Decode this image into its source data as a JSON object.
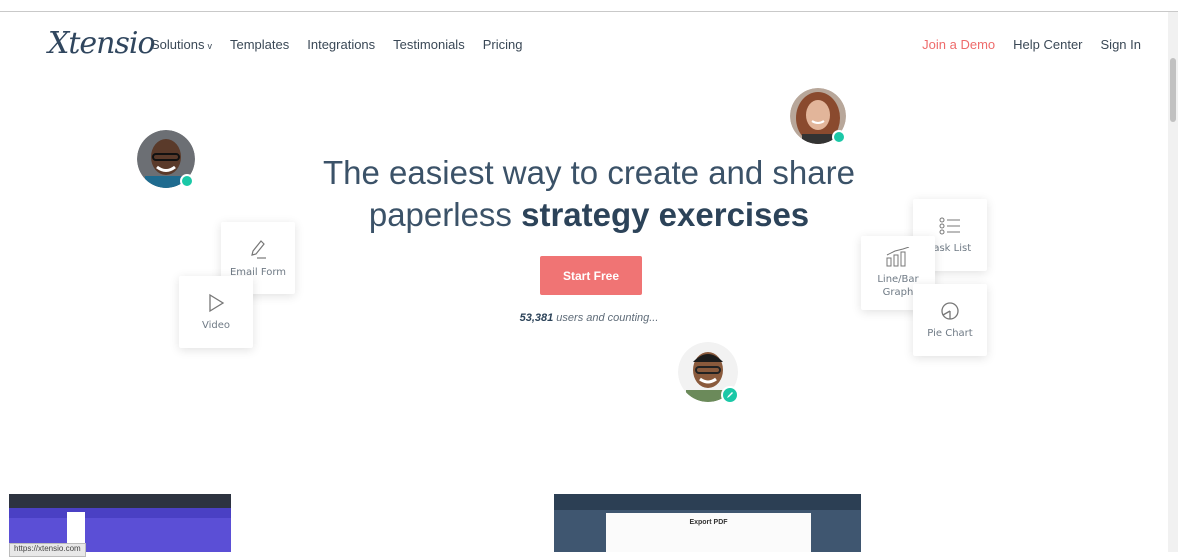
{
  "brand": {
    "logo": "Xtensio"
  },
  "nav": {
    "left": [
      "Solutions",
      "Templates",
      "Integrations",
      "Testimonials",
      "Pricing"
    ],
    "right": [
      "Join a Demo",
      "Help Center",
      "Sign In"
    ]
  },
  "hero": {
    "line1": "The easiest way to create and share",
    "line2_prefix": "paperless ",
    "line2_bold": "strategy exercises",
    "cta": "Start Free",
    "users_count": "53,381",
    "users_suffix": " users and counting..."
  },
  "cards": {
    "email_form": "Email Form",
    "video": "Video",
    "task_list": "Task List",
    "line_bar": "Line/Bar Graph",
    "pie_chart": "Pie Chart"
  },
  "thumbs": {
    "url": "https://xtensio.com",
    "export_title": "Export PDF"
  },
  "colors": {
    "accent": "#f07474",
    "online": "#1bc8a7",
    "heading": "#3b5268"
  }
}
